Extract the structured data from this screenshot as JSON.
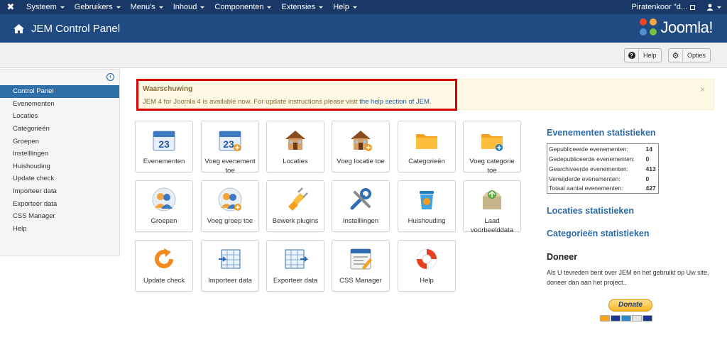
{
  "topbar": {
    "logo": "✖",
    "menus": [
      "Systeem",
      "Gebruikers",
      "Menu's",
      "Inhoud",
      "Componenten",
      "Extensies",
      "Help"
    ],
    "site_link": "Piratenkoor \"d...",
    "user_icon": "user-icon"
  },
  "header": {
    "title": "JEM Control Panel",
    "brand": "Joomla!"
  },
  "toolbar": {
    "help_label": "Help",
    "options_label": "Opties"
  },
  "sidebar": {
    "items": [
      {
        "label": "Control Panel",
        "active": true
      },
      {
        "label": "Evenementen"
      },
      {
        "label": "Locaties"
      },
      {
        "label": "Categorieën"
      },
      {
        "label": "Groepen"
      },
      {
        "label": "Instelllingen"
      },
      {
        "label": "Huishouding"
      },
      {
        "label": "Update check"
      },
      {
        "label": "Importeer data"
      },
      {
        "label": "Exporteer data"
      },
      {
        "label": "CSS Manager"
      },
      {
        "label": "Help"
      }
    ]
  },
  "alert": {
    "title": "Waarschuwing",
    "text_before": "JEM 4 for Joomla 4 is available now. For update instructions please visit ",
    "link": "the help section of JEM",
    "text_after": ".",
    "close": "×"
  },
  "tiles": [
    {
      "label": "Evenementen",
      "icon": "calendar-icon"
    },
    {
      "label": "Voeg evenement toe",
      "icon": "calendar-add-icon"
    },
    {
      "label": "Locaties",
      "icon": "house-icon"
    },
    {
      "label": "Voeg locatie toe",
      "icon": "house-add-icon"
    },
    {
      "label": "Categorieën",
      "icon": "folder-icon"
    },
    {
      "label": "Voeg categorie toe",
      "icon": "folder-add-icon"
    },
    {
      "label": "Groepen",
      "icon": "group-icon"
    },
    {
      "label": "Voeg groep toe",
      "icon": "group-add-icon"
    },
    {
      "label": "Bewerk plugins",
      "icon": "plug-icon"
    },
    {
      "label": "Instelllingen",
      "icon": "tools-icon"
    },
    {
      "label": "Huishouding",
      "icon": "trash-icon"
    },
    {
      "label": "Laad voorbeelddata",
      "icon": "box-icon"
    },
    {
      "label": "Update check",
      "icon": "refresh-icon"
    },
    {
      "label": "Importeer data",
      "icon": "import-icon"
    },
    {
      "label": "Exporteer data",
      "icon": "export-icon"
    },
    {
      "label": "CSS Manager",
      "icon": "css-icon"
    },
    {
      "label": "Help",
      "icon": "lifebuoy-icon"
    }
  ],
  "stats": {
    "events_title": "Evenementen statistieken",
    "rows": [
      {
        "label": "Gepubliceerde evenementen:",
        "value": "14"
      },
      {
        "label": "Gedepubliceerde evenementen:",
        "value": "0"
      },
      {
        "label": "Gearchiveerde evenementen:",
        "value": "413"
      },
      {
        "label": "Verwijderde evenementen:",
        "value": "0"
      },
      {
        "label": "Totaal aantal evenementen:",
        "value": "427"
      }
    ],
    "locations_title": "Locaties statistieken",
    "categories_title": "Categorieën statistieken"
  },
  "donate": {
    "title": "Doneer",
    "text": "Als U tevreden bent over JEM en het gebruikt op Uw site, doneer dan aan het project..",
    "button": "Donate"
  }
}
